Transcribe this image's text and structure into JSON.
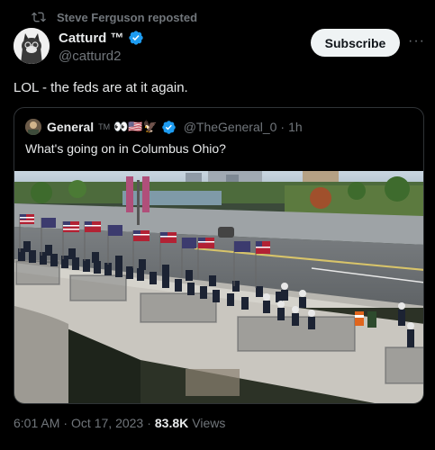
{
  "repost": {
    "text": "Steve Ferguson reposted"
  },
  "author": {
    "name": "Catturd ™",
    "handle": "@catturd2"
  },
  "actions": {
    "subscribe_label": "Subscribe",
    "more_label": "···"
  },
  "tweet": {
    "text": "LOL - the feds are at it again."
  },
  "quote": {
    "name": "General",
    "tm": "TM",
    "emoji": "👀🇺🇸🦅",
    "handle": "@TheGeneral_0",
    "dot": "·",
    "time": "1h",
    "text": "What's going on in Columbus Ohio?"
  },
  "footer": {
    "time": "6:01 AM",
    "date": "Oct 17, 2023",
    "views_count": "83.8K",
    "views_label": "Views",
    "sep": "·"
  },
  "colors": {
    "accent": "#1d9bf0",
    "muted": "#71767b",
    "text": "#e7e9ea",
    "border": "#2f3336",
    "bg": "#000000"
  }
}
